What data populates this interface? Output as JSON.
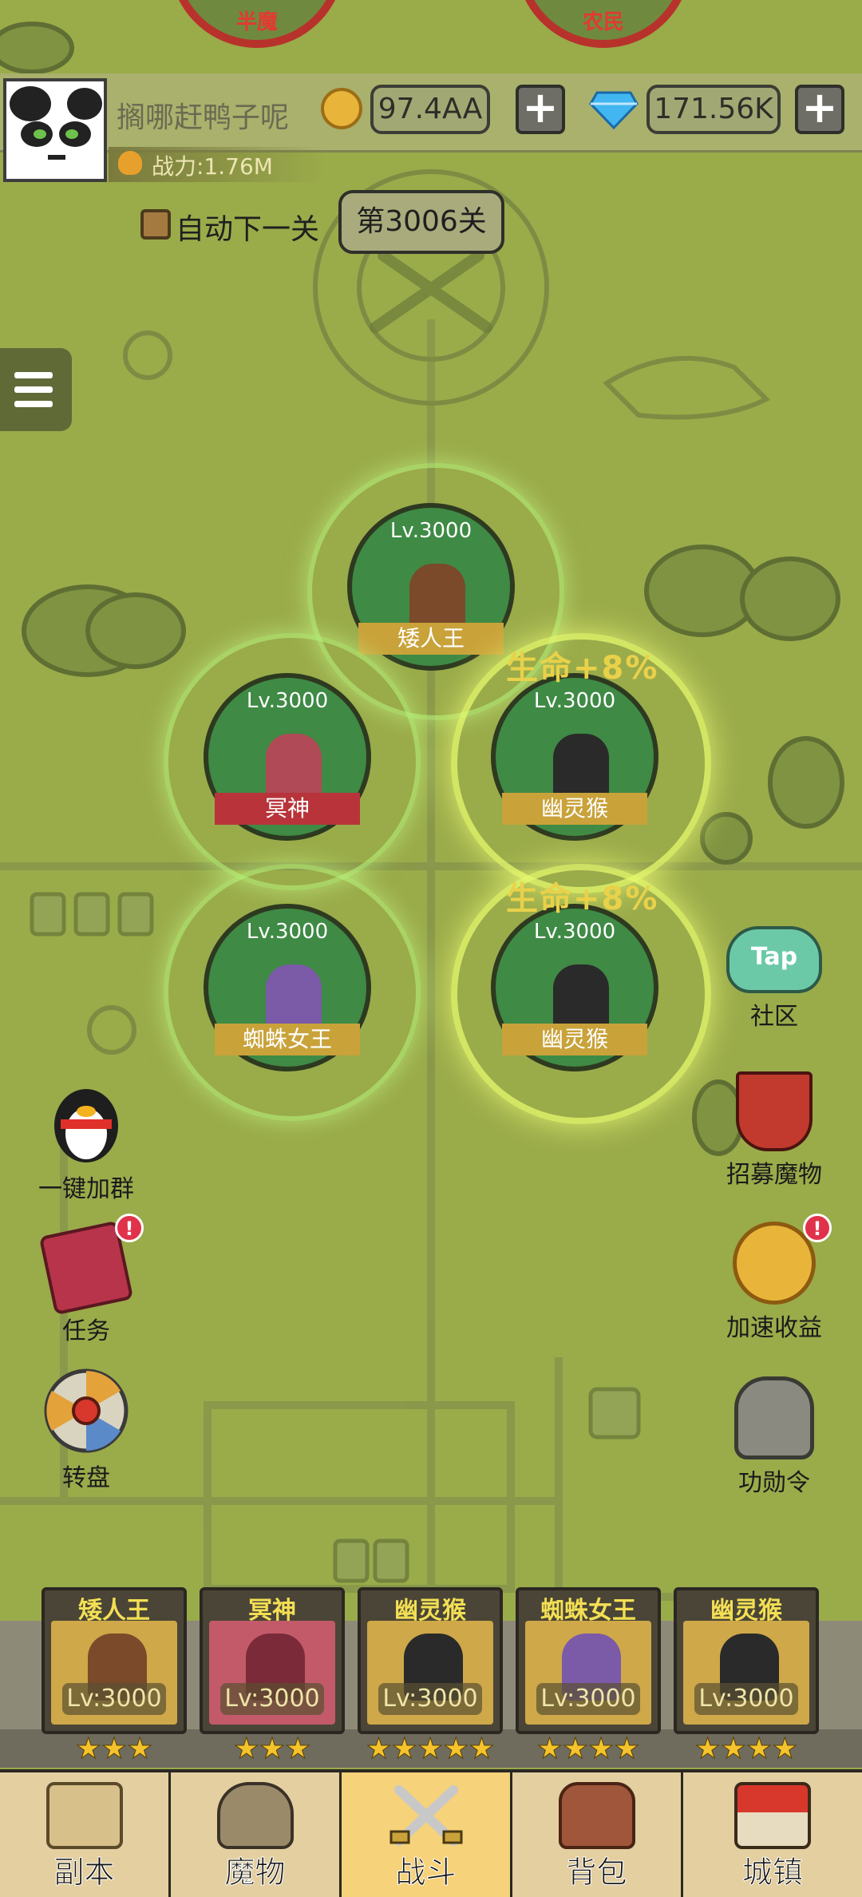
{
  "enemies": [
    {
      "name": "半魔"
    },
    {
      "name": "农民"
    }
  ],
  "player": {
    "name": "搁哪赶鸭子呢",
    "gold": "97.4AA",
    "diamonds": "171.56K",
    "power": "战力:1.76M"
  },
  "controls": {
    "auto_next_label": "自动下一关",
    "stage": "第3006关"
  },
  "formation": [
    {
      "level": "Lv.3000",
      "name": "矮人王",
      "tag_color": "#c9a23a"
    },
    {
      "level": "Lv.3000",
      "name": "冥神",
      "tag_color": "#b8343a"
    },
    {
      "level": "Lv.3000",
      "name": "幽灵猴",
      "tag_color": "#c9a23a",
      "buff": "生命+8%"
    },
    {
      "level": "Lv.3000",
      "name": "蜘蛛女王",
      "tag_color": "#c9a23a"
    },
    {
      "level": "Lv.3000",
      "name": "幽灵猴",
      "tag_color": "#c9a23a",
      "buff": "生命+8%"
    }
  ],
  "left_buttons": [
    {
      "label": "一键加群",
      "icon": "penguin-icon"
    },
    {
      "label": "任务",
      "icon": "quest-book-icon",
      "badge": "!"
    },
    {
      "label": "转盘",
      "icon": "wheel-icon"
    }
  ],
  "right_buttons": [
    {
      "label": "社区",
      "icon": "tap-cloud-icon",
      "icon_text": "Tap"
    },
    {
      "label": "招募魔物",
      "icon": "recruit-banner-icon"
    },
    {
      "label": "加速收益",
      "icon": "coin-boost-icon",
      "badge": "!"
    },
    {
      "label": "功勋令",
      "icon": "helmet-icon"
    }
  ],
  "lineup": [
    {
      "name": "矮人王",
      "level": "Lv:3000",
      "stars": "★★★",
      "bg": "#cea849"
    },
    {
      "name": "冥神",
      "level": "Lv:3000",
      "stars": "★★★",
      "bg": "#c25a6a"
    },
    {
      "name": "幽灵猴",
      "level": "Lv:3000",
      "stars": "★★★★★",
      "bg": "#cea849"
    },
    {
      "name": "蜘蛛女王",
      "level": "Lv:3000",
      "stars": "★★★★",
      "bg": "#cea849"
    },
    {
      "name": "幽灵猴",
      "level": "Lv:3000",
      "stars": "★★★★",
      "bg": "#cea849"
    }
  ],
  "nav": [
    {
      "label": "副本",
      "icon": "map-scroll-icon"
    },
    {
      "label": "魔物",
      "icon": "monster-helmet-icon"
    },
    {
      "label": "战斗",
      "icon": "crossed-swords-icon",
      "active": true
    },
    {
      "label": "背包",
      "icon": "backpack-icon"
    },
    {
      "label": "城镇",
      "icon": "town-house-icon"
    }
  ]
}
